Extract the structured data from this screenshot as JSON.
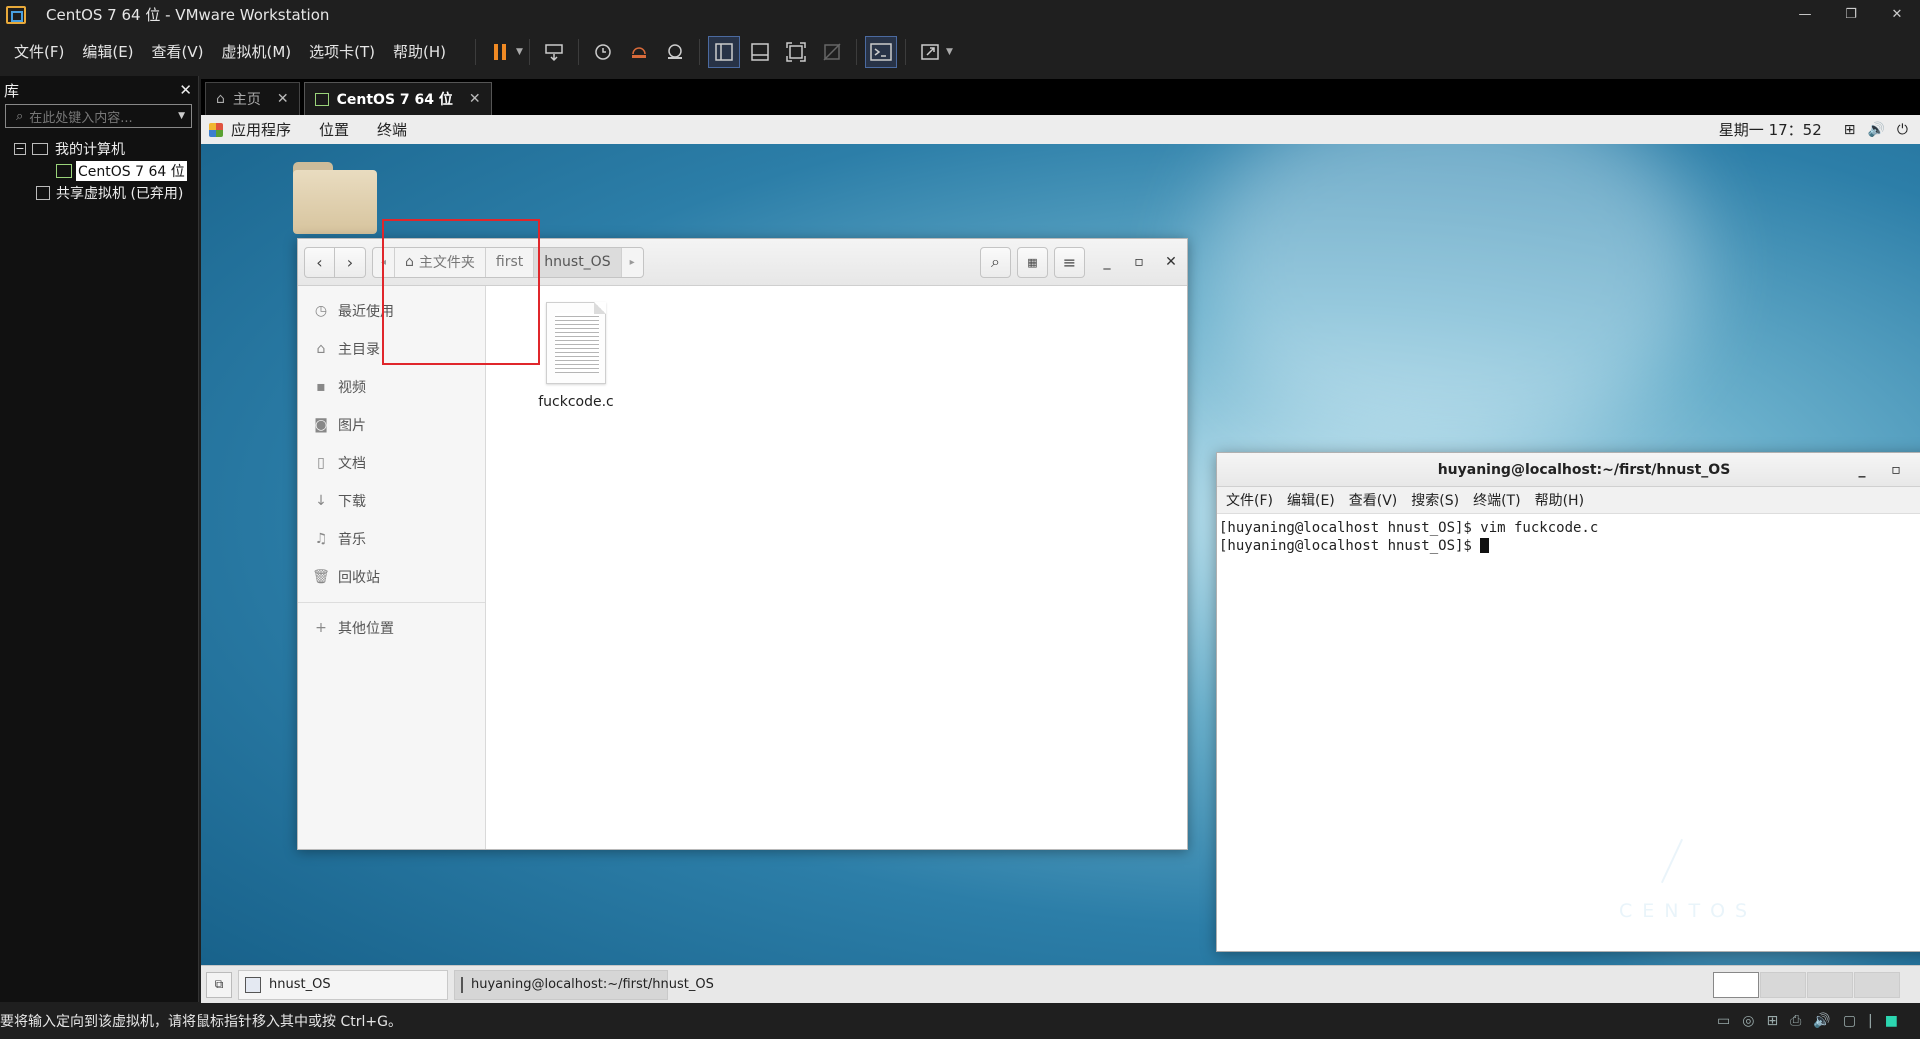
{
  "window": {
    "title": "CentOS 7 64 位 - VMware Workstation"
  },
  "menubar": {
    "items": [
      "文件(F)",
      "编辑(E)",
      "查看(V)",
      "虚拟机(M)",
      "选项卡(T)",
      "帮助(H)"
    ]
  },
  "library": {
    "title": "库",
    "search_placeholder": "在此处键入内容...",
    "tree": {
      "my_computer": "我的计算机",
      "vm": "CentOS 7 64 位",
      "shared": "共享虚拟机 (已弃用)"
    }
  },
  "tabs": [
    {
      "label": "主页",
      "active": false
    },
    {
      "label": "CentOS 7 64 位",
      "active": true
    }
  ],
  "gnome_topbar": {
    "menus": [
      "应用程序",
      "位置",
      "终端"
    ],
    "clock": "星期一 17：52"
  },
  "nautilus": {
    "breadcrumbs": [
      "主文件夹",
      "first",
      "hnust_OS"
    ],
    "sidebar": [
      "最近使用",
      "主目录",
      "视频",
      "图片",
      "文档",
      "下载",
      "音乐",
      "回收站"
    ],
    "other_locations": "其他位置",
    "files": [
      {
        "name": "fuckcode.c",
        "icon": "text-file-icon"
      }
    ]
  },
  "terminal": {
    "title": "huyaning@localhost:~/first/hnust_OS",
    "menus": [
      "文件(F)",
      "编辑(E)",
      "查看(V)",
      "搜索(S)",
      "终端(T)",
      "帮助(H)"
    ],
    "lines": [
      "[huyaning@localhost hnust_OS]$ vim fuckcode.c",
      "[huyaning@localhost hnust_OS]$ "
    ]
  },
  "taskbar": {
    "items": [
      {
        "label": "hnust_OS",
        "active": false
      },
      {
        "label": "huyaning@localhost:~/first/hnust_OS",
        "active": true
      }
    ]
  },
  "desktop": {
    "branding": "CENTOS"
  },
  "statusbar": {
    "hint": "要将输入定向到该虚拟机，请将鼠标指针移入其中或按 Ctrl+G。"
  },
  "colors": {
    "highlight_box": "#e0262b",
    "pause_button": "#f08a24"
  }
}
